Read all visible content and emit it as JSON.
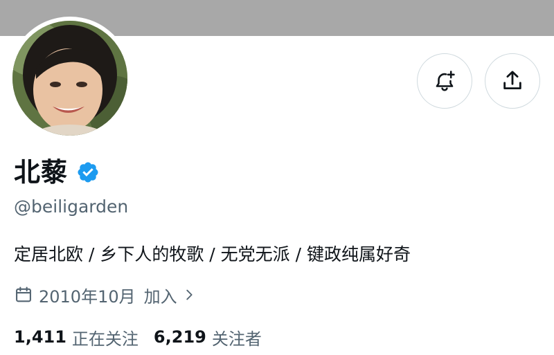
{
  "colors": {
    "banner": "#a8a8a8",
    "text_primary": "#0f1419",
    "text_secondary": "#536471",
    "button_border": "#cfd9de",
    "verified_badge": "#1d9bf0"
  },
  "profile": {
    "display_name": "北藜",
    "verified": true,
    "handle": "@beiligarden",
    "bio": "定居北欧 / 乡下人的牧歌 / 无党无派 / 键政纯属好奇",
    "join_date": "2010年10月",
    "join_link_label": "加入"
  },
  "actions": [
    {
      "icon": "bell-plus-icon"
    },
    {
      "icon": "share-upload-icon"
    }
  ],
  "stats": {
    "following_count": "1,411",
    "following_label": "正在关注",
    "followers_count": "6,219",
    "followers_label": "关注者"
  }
}
